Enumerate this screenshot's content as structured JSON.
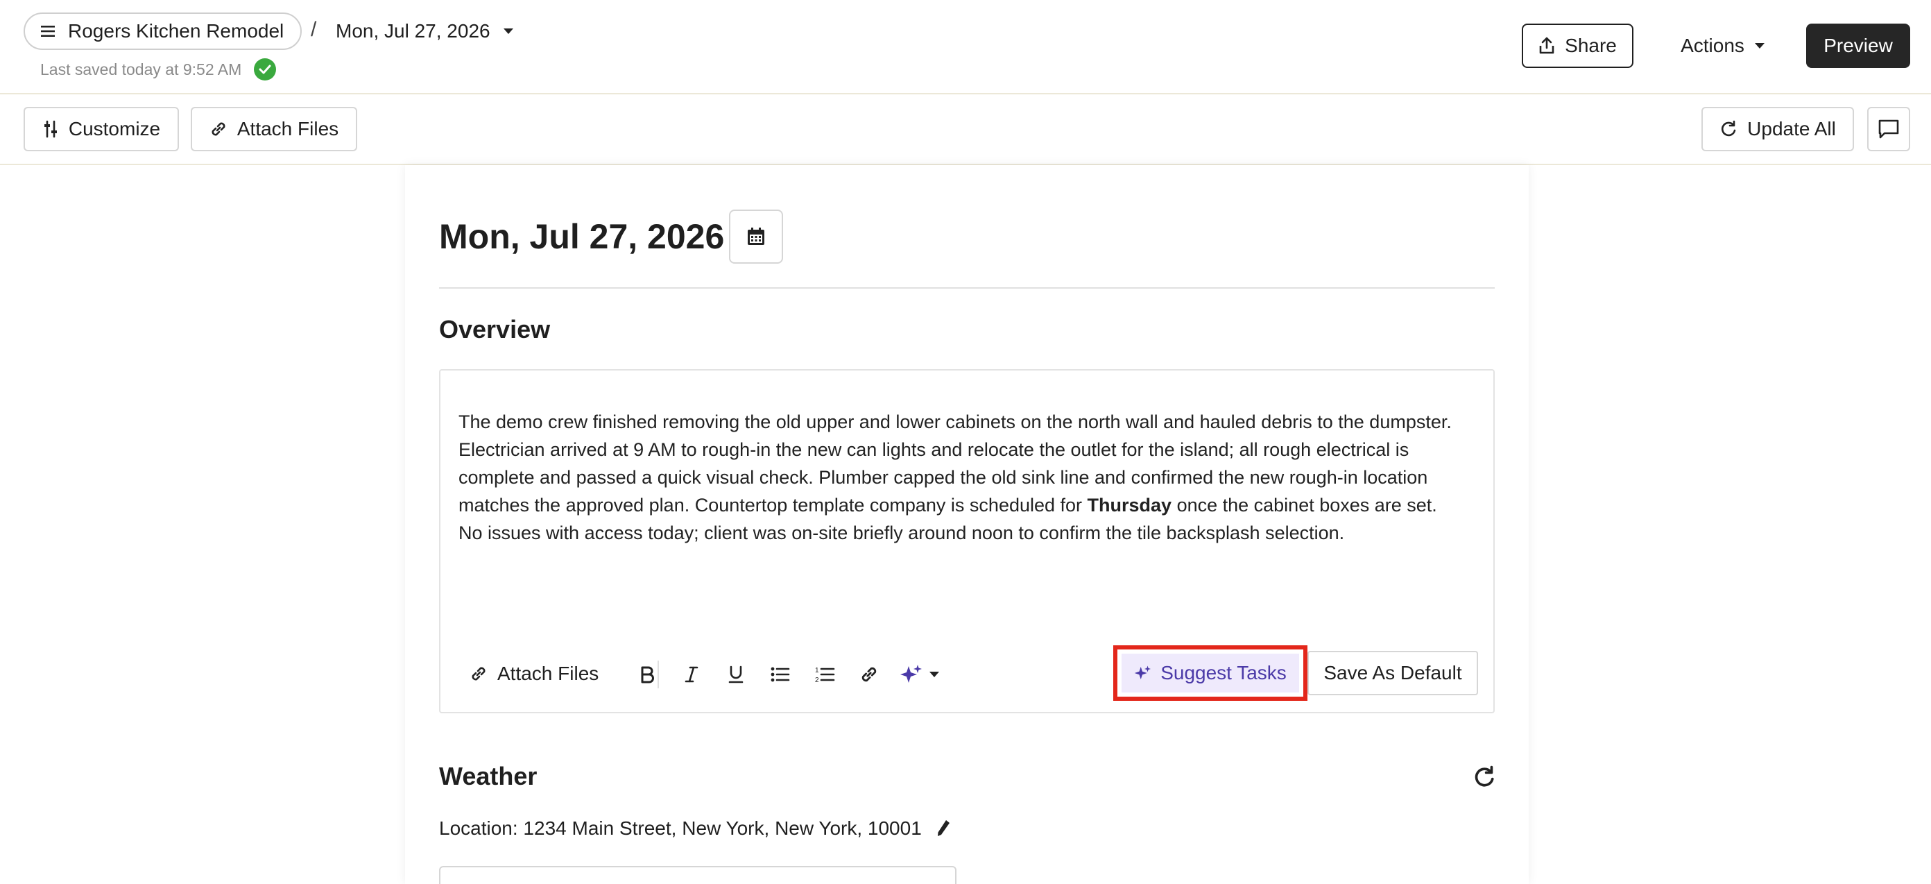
{
  "header": {
    "project_name": "Rogers Kitchen Remodel",
    "separator": "/",
    "report_date": "Mon, Jul 27, 2026",
    "saved_status": "Last saved today at 9:52 AM",
    "share_label": "Share",
    "actions_label": "Actions",
    "preview_label": "Preview"
  },
  "toolbar": {
    "customize_label": "Customize",
    "attach_label": "Attach Files",
    "update_all_label": "Update All"
  },
  "report": {
    "date_title": "Mon, Jul 27, 2026",
    "overview": {
      "title": "Overview",
      "text_part1": "The demo crew finished removing the old upper and lower cabinets on the north wall and hauled debris to the dumpster. Electrician arrived at 9 AM to rough-in the new can lights and relocate the outlet for the island; all rough electrical is complete and passed a quick visual check. Plumber capped the old sink line and confirmed the new rough-in location matches the approved plan. Countertop template company is scheduled for ",
      "text_bold": "Thursday",
      "text_part2": " once the cabinet boxes are set. No issues with access today; client was on-site briefly around noon to confirm the tile backsplash selection.",
      "attach_label": "Attach Files",
      "suggest_label": "Suggest Tasks",
      "save_default_label": "Save As Default"
    },
    "weather": {
      "title": "Weather",
      "location": "Location: 1234 Main Street, New York, New York, 10001"
    }
  },
  "colors": {
    "accent_purple": "#4b3aa8",
    "highlight_red": "#e3271b",
    "saved_green": "#3aa93e"
  }
}
